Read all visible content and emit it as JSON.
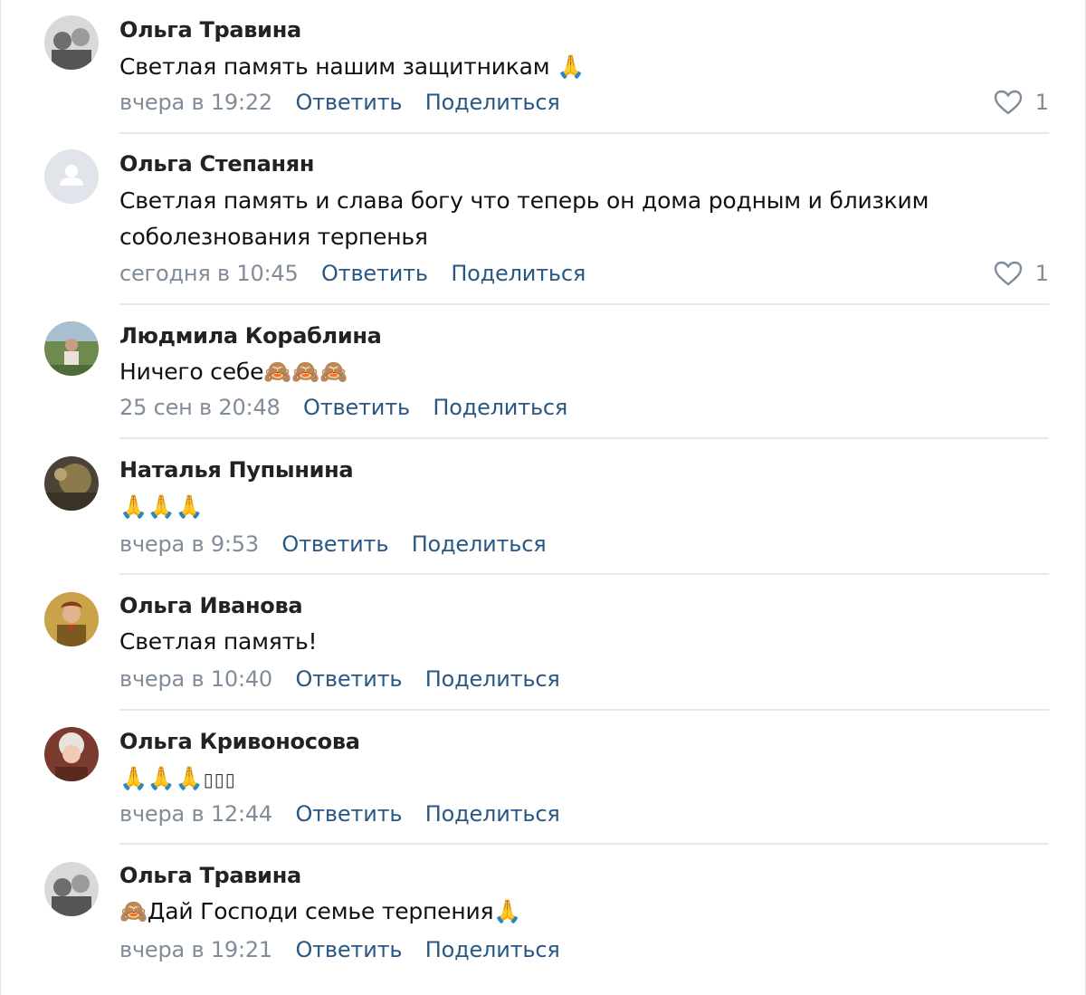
{
  "colors": {
    "author": "#222222",
    "text": "#111111",
    "date": "#818c99",
    "link": "#2a5885",
    "divider": "#e7e8ec",
    "avatar_placeholder": "#e1e5eb"
  },
  "actions": {
    "reply": "Ответить",
    "share": "Поделиться"
  },
  "comments": [
    {
      "author": "Ольга Травина",
      "text": "Светлая память нашим защитникам 🙏",
      "date": "вчера в 19:22",
      "likes": "1",
      "avatar_icon": "photo-avatar-icon"
    },
    {
      "author": "Ольга Степанян",
      "text_line1": "Светлая память и слава богу что теперь он дома родным и близким",
      "text_line2": "соболезнования терпенья",
      "date": "сегодня в 10:45",
      "likes": "1",
      "avatar_icon": "user-placeholder-icon"
    },
    {
      "author": "Людмила Кораблина",
      "text": "Ничего себе🙈🙈🙈",
      "date": "25 сен в 20:48",
      "avatar_icon": "photo-avatar-icon"
    },
    {
      "author": "Наталья Пупынина",
      "text": "🙏🙏🙏",
      "date": "вчера в 9:53",
      "avatar_icon": "photo-avatar-icon"
    },
    {
      "author": "Ольга Иванова",
      "text": "Светлая память!",
      "date": "вчера в 10:40",
      "avatar_icon": "photo-avatar-icon"
    },
    {
      "author": "Ольга Кривоносова",
      "text": "🙏🙏🙏",
      "text_tail": "▯▯▯",
      "date": "вчера в 12:44",
      "avatar_icon": "photo-avatar-icon"
    },
    {
      "author": "Ольга Травина",
      "text": "🙈Дай Господи семье терпения🙏",
      "date": "вчера в 19:21",
      "avatar_icon": "photo-avatar-icon"
    }
  ]
}
